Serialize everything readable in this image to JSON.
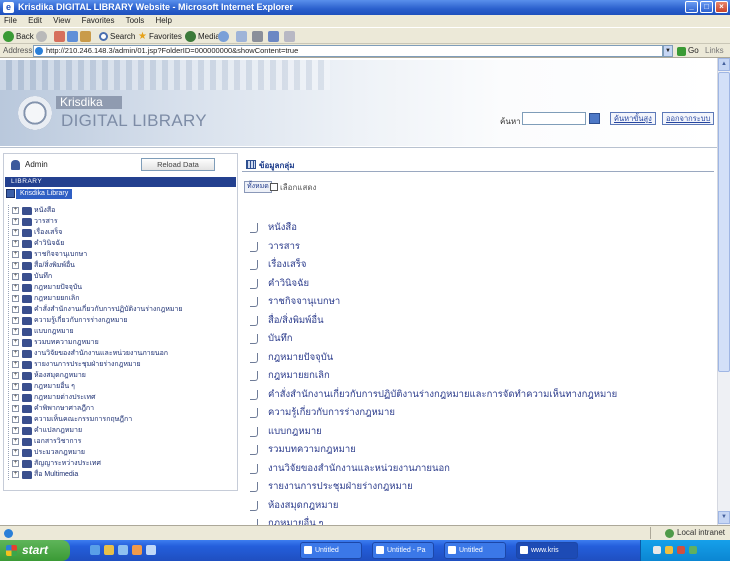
{
  "window": {
    "title": "Krisdika DIGITAL LIBRARY Website - Microsoft Internet Explorer"
  },
  "menu": {
    "file": "File",
    "edit": "Edit",
    "view": "View",
    "favorites": "Favorites",
    "tools": "Tools",
    "help": "Help"
  },
  "toolbar": {
    "back": "Back",
    "search": "Search",
    "favorites": "Favorites",
    "media": "Media"
  },
  "address": {
    "label": "Address",
    "url": "http://210.246.148.3/admin/01.jsp?FolderID=000000000&showContent=true",
    "go": "Go",
    "links": "Links"
  },
  "header": {
    "brand_top": "Krisdika",
    "brand_main": "DIGITAL LIBRARY",
    "search_label": "ค้นหา",
    "search_value": "",
    "advanced_search": "ค้นหาขั้นสูง",
    "logout": "ออกจากระบบ"
  },
  "left": {
    "user": "Admin",
    "reload": "Reload Data",
    "bar_label": "LIBRARY",
    "root_label": "Krisdika Library",
    "items": [
      "หนังสือ",
      "วารสาร",
      "เรื่องเสร็จ",
      "คำวินิจฉัย",
      "ราชกิจจานุเบกษา",
      "สื่อ/สิ่งพิมพ์อื่น",
      "บันทึก",
      "กฎหมายปัจจุบัน",
      "กฎหมายยกเลิก",
      "คำสั่งสำนักงานเกี่ยวกับการปฏิบัติงานร่างกฎหมาย",
      "ความรู้เกี่ยวกับการร่างกฎหมาย",
      "แบบกฎหมาย",
      "รวมบทความกฎหมาย",
      "งานวิจัยของสำนักงานและหน่วยงานภายนอก",
      "รายงานการประชุมฝ่ายร่างกฎหมาย",
      "ห้องสมุดกฎหมาย",
      "กฎหมายอื่น ๆ",
      "กฎหมายต่างประเทศ",
      "คำพิพากษาศาลฎีกา",
      "ความเห็นคณะกรรมการกฤษฎีกา",
      "คำแปลกฎหมาย",
      "เอกสารวิชาการ",
      "ประมวลกฎหมาย",
      "สัญญาระหว่างประเทศ",
      "สื่อ Multimedia"
    ]
  },
  "right": {
    "title": "ข้อมูลกลุ่ม",
    "all_button": "ทั้งหมด",
    "checkbox_label": "เลือกแสดง",
    "items": [
      "หนังสือ",
      "วารสาร",
      "เรื่องเสร็จ",
      "คำวินิจฉัย",
      "ราชกิจจานุเบกษา",
      "สื่อ/สิ่งพิมพ์อื่น",
      "บันทึก",
      "กฎหมายปัจจุบัน",
      "กฎหมายยกเลิก",
      "คำสั่งสำนักงานเกี่ยวกับการปฏิบัติงานร่างกฎหมายและการจัดทำความเห็นทางกฎหมาย",
      "ความรู้เกี่ยวกับการร่างกฎหมาย",
      "แบบกฎหมาย",
      "รวมบทความกฎหมาย",
      "งานวิจัยของสำนักงานและหน่วยงานภายนอก",
      "รายงานการประชุมฝ่ายร่างกฎหมาย",
      "ห้องสมุดกฎหมาย",
      "กฎหมายอื่น ๆ"
    ]
  },
  "status": {
    "zone": "Local intranet"
  },
  "taskbar": {
    "start": "start",
    "tasks": [
      "Untitled",
      "Untitled - Pa",
      "Untitled",
      "www.kris"
    ]
  },
  "colors": {
    "accent": "#2f5fc4",
    "taskbar": "#245edb",
    "start": "#3a9a35"
  }
}
